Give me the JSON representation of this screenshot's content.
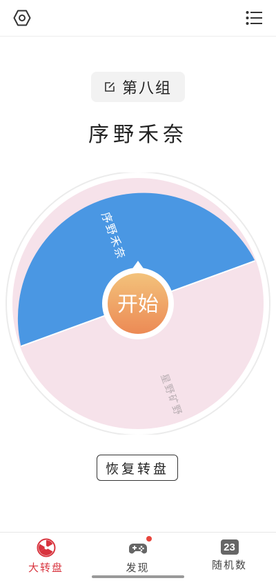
{
  "header": {
    "settings_icon": "hexagon-settings-icon",
    "menu_icon": "list-menu-icon"
  },
  "group": {
    "icon": "edit-icon",
    "label": "第八组"
  },
  "result": {
    "name": "序野禾奈"
  },
  "wheel": {
    "center_label": "开始",
    "segments": [
      {
        "label": "序野禾奈",
        "color": "#4a97e3"
      },
      {
        "label": "星野矿野",
        "color": "#f6e2ea"
      }
    ]
  },
  "reset_label": "恢复转盘",
  "tabs": [
    {
      "label": "大转盘",
      "icon": "radiation-wheel-icon",
      "active": true
    },
    {
      "label": "发现",
      "icon": "gamepad-icon",
      "badge": true
    },
    {
      "label": "随机数",
      "icon": "number-icon",
      "number": "23"
    }
  ],
  "colors": {
    "accent": "#d8343e",
    "wheel_blue": "#4a97e3",
    "wheel_pink": "#f6e2ea",
    "center_top": "#f3c27b",
    "center_bottom": "#ec8a55"
  }
}
